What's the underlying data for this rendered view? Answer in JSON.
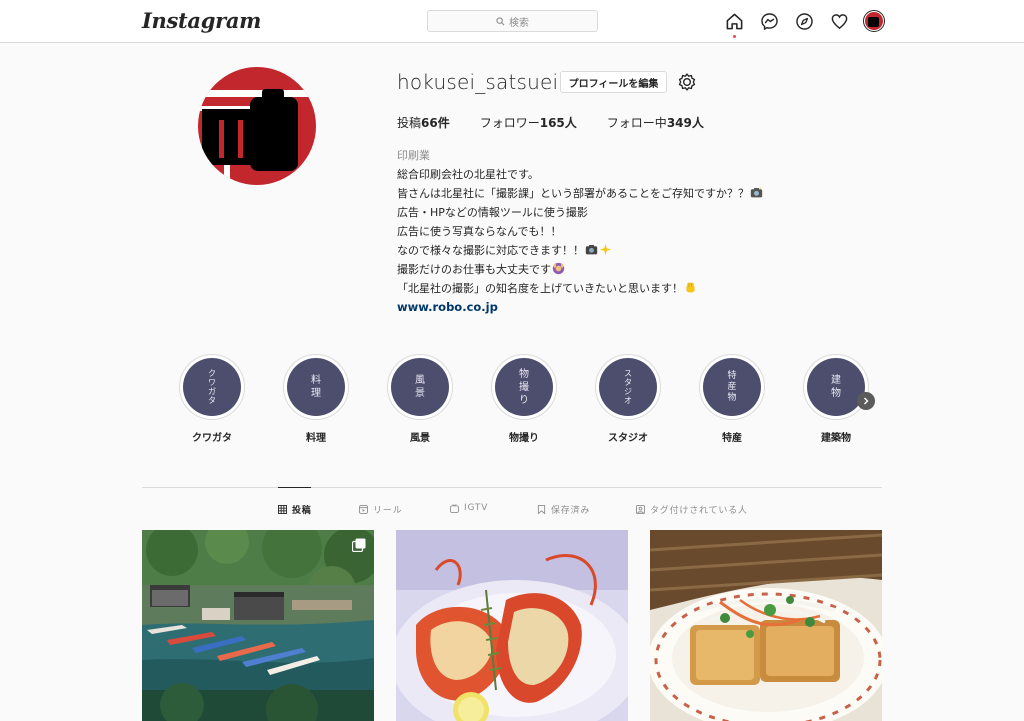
{
  "nav": {
    "logo": "Instagram",
    "search_placeholder": "検索"
  },
  "profile": {
    "username": "hokusei_satsuei",
    "edit_button": "プロフィールを編集",
    "stats": {
      "posts_label": "投稿",
      "posts_count": "66件",
      "followers_label": "フォロワー",
      "followers_count": "165人",
      "following_label": "フォロー中",
      "following_count": "349人"
    },
    "bio": {
      "category": "印刷業",
      "lines": [
        "総合印刷会社の北星社です。",
        "皆さんは北星社に「撮影課」という部署があることをご存知ですか？？",
        "広告・HPなどの情報ツールに使う撮影",
        "広告に使う写真ならなんでも！！",
        "なので様々な撮影に対応できます！！",
        "撮影だけのお仕事も大丈夫です",
        "「北星社の撮影」の知名度を上げていきたいと思います！"
      ],
      "emojis": [
        "camera-flash-emoji",
        "camera-sparkles-emoji",
        "person-raising-hands-emoji",
        "fist-emoji"
      ],
      "website": "www.robo.co.jp"
    }
  },
  "highlights": [
    {
      "title": "クワガタ",
      "cover_text": "クワガタ"
    },
    {
      "title": "料理",
      "cover_text": "料理"
    },
    {
      "title": "風景",
      "cover_text": "風景"
    },
    {
      "title": "物撮り",
      "cover_text": "物撮り"
    },
    {
      "title": "スタジオ",
      "cover_text": "スタジオ"
    },
    {
      "title": "特産",
      "cover_text": "特産物"
    },
    {
      "title": "建築物",
      "cover_text": "建物"
    }
  ],
  "tabs": [
    {
      "label": "投稿",
      "icon": "grid-icon",
      "active": true
    },
    {
      "label": "リール",
      "icon": "reels-icon",
      "active": false
    },
    {
      "label": "IGTV",
      "icon": "igtv-icon",
      "active": false
    },
    {
      "label": "保存済み",
      "icon": "bookmark-icon",
      "active": false
    },
    {
      "label": "タグ付けされている人",
      "icon": "tagged-icon",
      "active": false
    }
  ],
  "posts": [
    {
      "subject": "harbor village with carp streamers",
      "multi": true
    },
    {
      "subject": "grilled lobster dish",
      "multi": false
    },
    {
      "subject": "fried tofu with vegetables",
      "multi": false
    }
  ],
  "colors": {
    "highlight_cover": "#4d4e6e",
    "link": "#00376b",
    "brand_red": "#c1272d",
    "notification_dot": "#ed4956"
  }
}
